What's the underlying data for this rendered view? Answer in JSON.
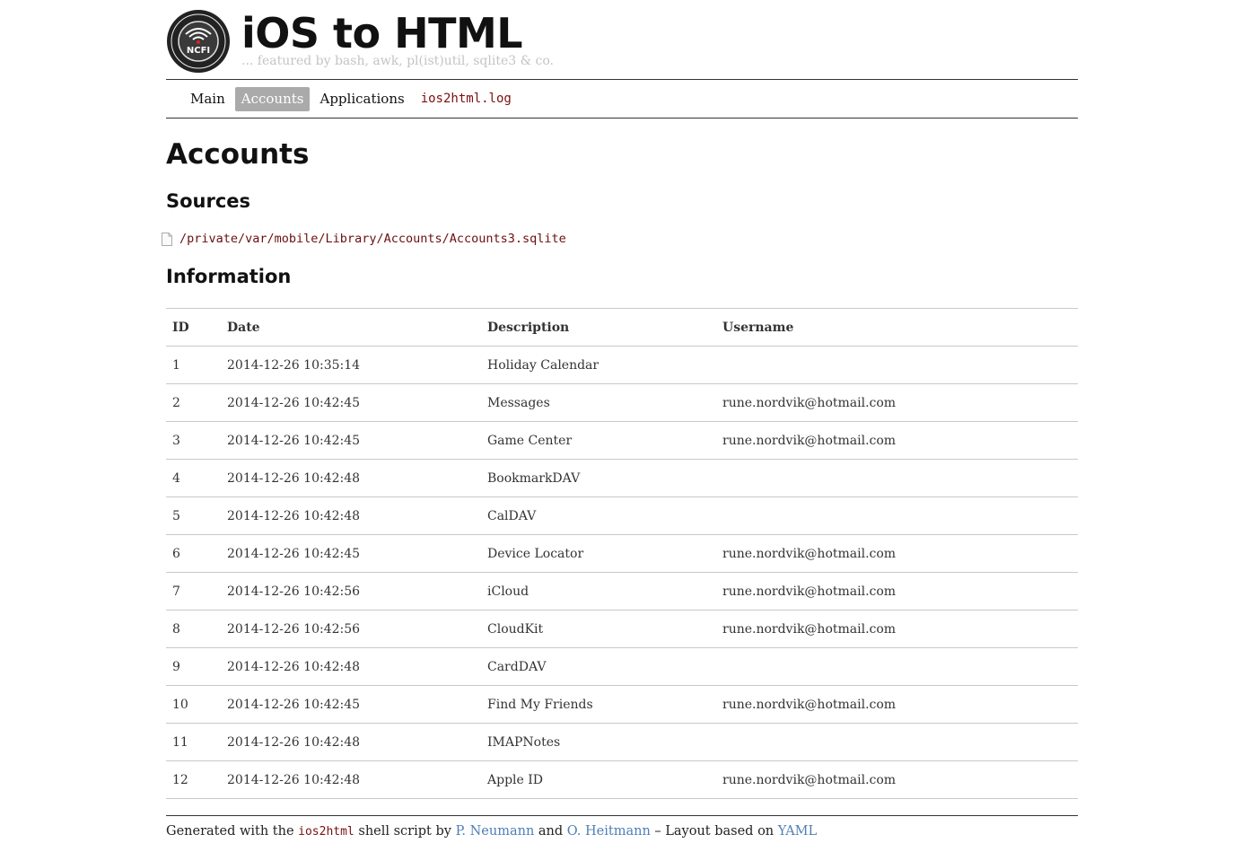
{
  "header": {
    "title": "iOS to HTML",
    "subtitle": "... featured by bash, awk, pl(ist)util, sqlite3 & co.",
    "logo_text": "NCFI"
  },
  "nav": {
    "items": [
      {
        "label": "Main"
      },
      {
        "label": "Accounts"
      },
      {
        "label": "Applications"
      },
      {
        "label": "ios2html.log"
      }
    ]
  },
  "page": {
    "heading": "Accounts",
    "sources_heading": "Sources",
    "source_path": "/private/var/mobile/Library/Accounts/Accounts3.sqlite",
    "information_heading": "Information"
  },
  "table": {
    "columns": [
      "ID",
      "Date",
      "Description",
      "Username"
    ],
    "rows": [
      [
        "1",
        "2014-12-26 10:35:14",
        "Holiday Calendar",
        ""
      ],
      [
        "2",
        "2014-12-26 10:42:45",
        "Messages",
        "rune.nordvik@hotmail.com"
      ],
      [
        "3",
        "2014-12-26 10:42:45",
        "Game Center",
        "rune.nordvik@hotmail.com"
      ],
      [
        "4",
        "2014-12-26 10:42:48",
        "BookmarkDAV",
        ""
      ],
      [
        "5",
        "2014-12-26 10:42:48",
        "CalDAV",
        ""
      ],
      [
        "6",
        "2014-12-26 10:42:45",
        "Device Locator",
        "rune.nordvik@hotmail.com"
      ],
      [
        "7",
        "2014-12-26 10:42:56",
        "iCloud",
        "rune.nordvik@hotmail.com"
      ],
      [
        "8",
        "2014-12-26 10:42:56",
        "CloudKit",
        "rune.nordvik@hotmail.com"
      ],
      [
        "9",
        "2014-12-26 10:42:48",
        "CardDAV",
        ""
      ],
      [
        "10",
        "2014-12-26 10:42:45",
        "Find My Friends",
        "rune.nordvik@hotmail.com"
      ],
      [
        "11",
        "2014-12-26 10:42:48",
        "IMAPNotes",
        ""
      ],
      [
        "12",
        "2014-12-26 10:42:48",
        "Apple ID",
        "rune.nordvik@hotmail.com"
      ]
    ]
  },
  "footer": {
    "text1": "Generated with the ",
    "script_name": "ios2html",
    "text2": " shell script by ",
    "author1": "P. Neumann",
    "text3": " and ",
    "author2": "O. Heitmann",
    "text4": " – Layout based on ",
    "layout_link": "YAML"
  },
  "colors": {
    "link": "#4e7fb8",
    "code": "#7a0f0f",
    "nav_active_bg": "#aaaaaa"
  }
}
